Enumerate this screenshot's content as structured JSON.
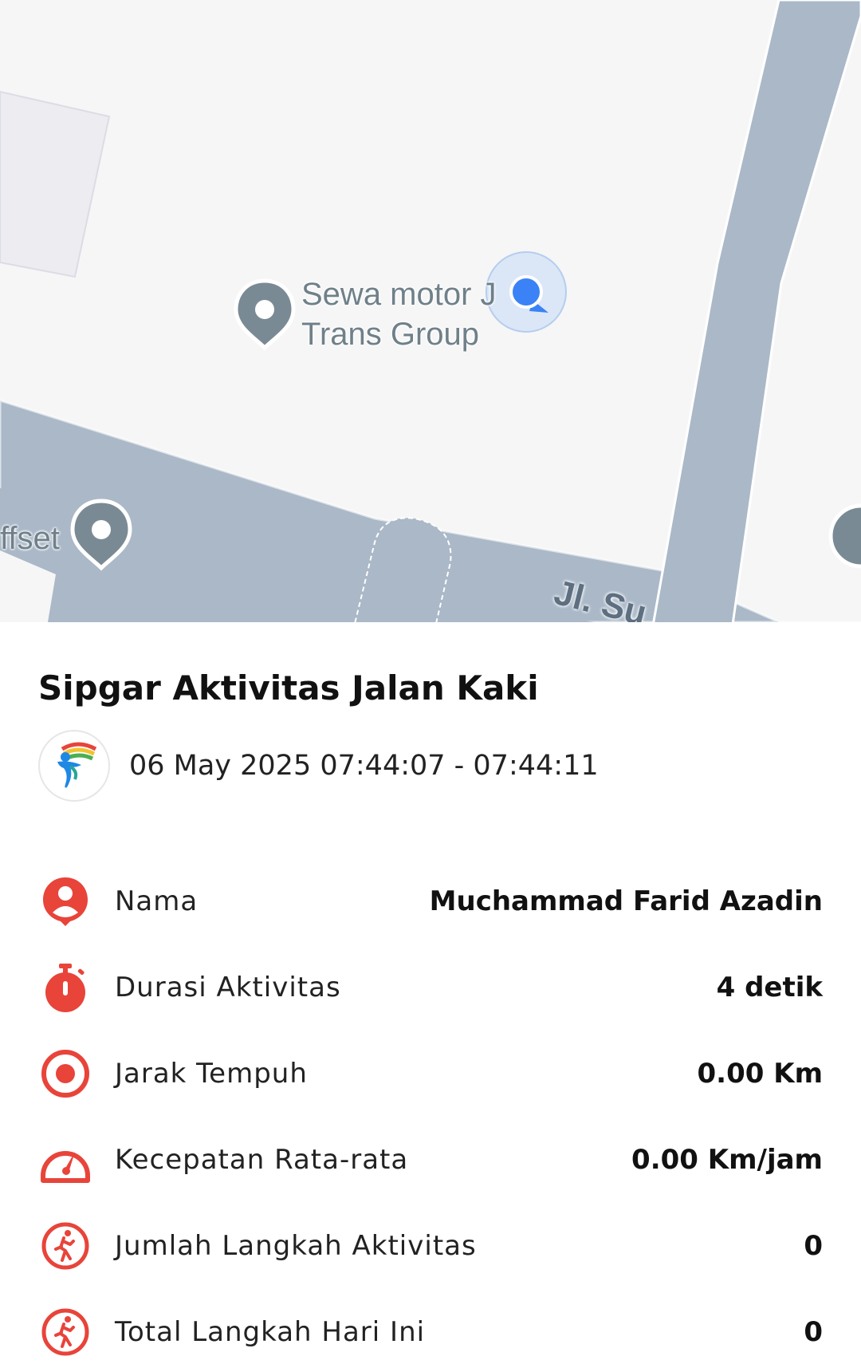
{
  "map": {
    "poi_label_line1": "Sewa motor J",
    "poi_label_line2": "Trans Group",
    "poi_left_label": "ffset",
    "street_label": "Jl. Su"
  },
  "activity": {
    "title": "Sipgar Aktivitas Jalan Kaki",
    "datetime": "06 May 2025 07:44:07 - 07:44:11"
  },
  "stats": [
    {
      "icon": "person-pin-icon",
      "label": "Nama",
      "value": "Muchammad Farid Azadin"
    },
    {
      "icon": "stopwatch-icon",
      "label": "Durasi Aktivitas",
      "value": "4 detik"
    },
    {
      "icon": "target-icon",
      "label": "Jarak Tempuh",
      "value": "0.00 Km"
    },
    {
      "icon": "speedometer-icon",
      "label": "Kecepatan Rata-rata",
      "value": "0.00 Km/jam"
    },
    {
      "icon": "walking-person-icon",
      "label": "Jumlah Langkah Aktivitas",
      "value": "0"
    },
    {
      "icon": "walking-person-icon",
      "label": "Total Langkah Hari Ini",
      "value": "0"
    }
  ],
  "colors": {
    "accent": "#e8443a",
    "road": "#aab8c8",
    "map_bg": "#f6f6f6",
    "location_dot": "#3b82f6"
  }
}
